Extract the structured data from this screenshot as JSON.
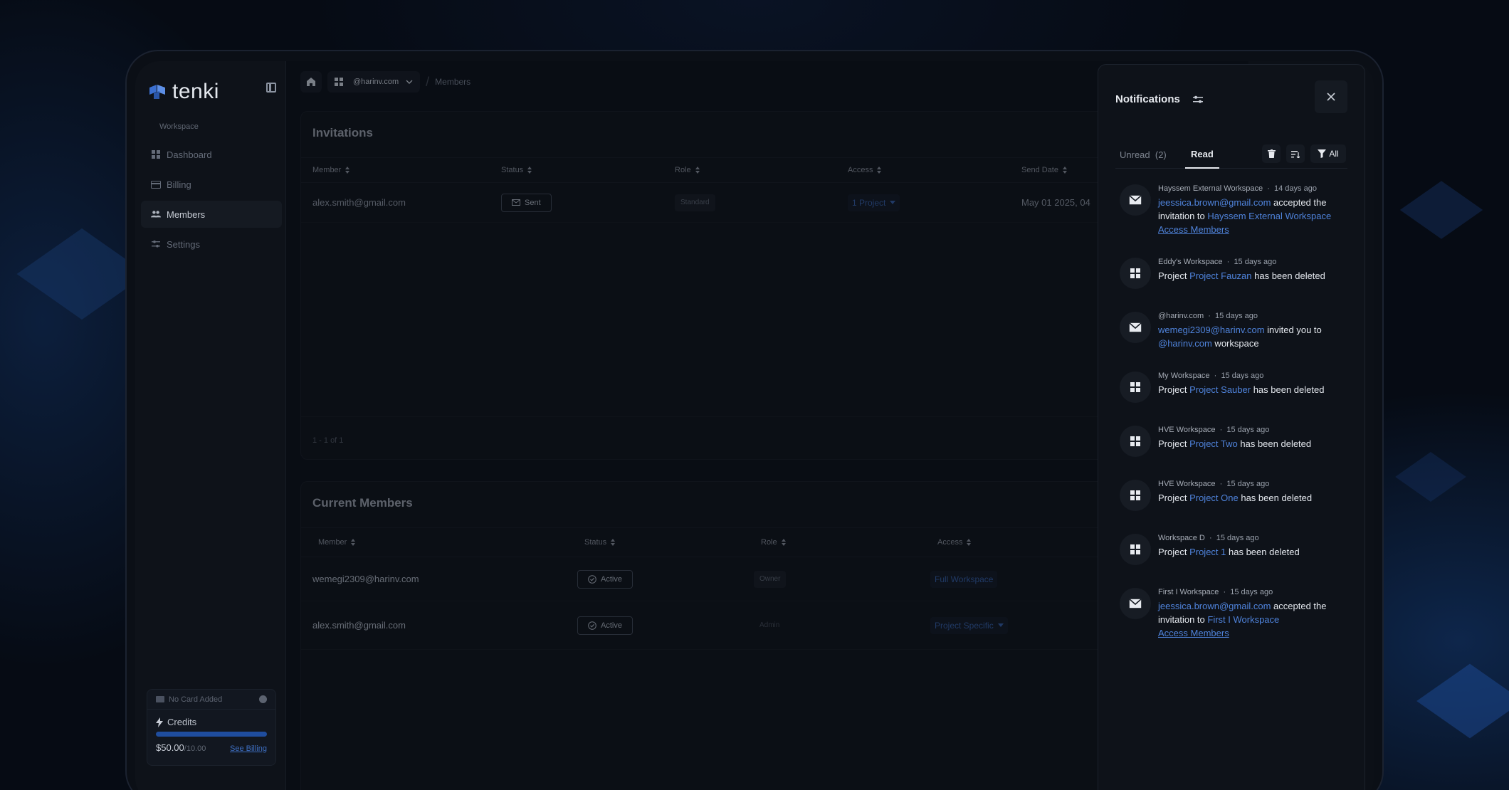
{
  "brand": {
    "name": "tenki",
    "accent": "#3e6fc2"
  },
  "sidebar": {
    "section_label": "Workspace",
    "items": [
      {
        "label": "Dashboard",
        "icon": "grid-icon",
        "active": false
      },
      {
        "label": "Billing",
        "icon": "card-icon",
        "active": false
      },
      {
        "label": "Members",
        "icon": "users-icon",
        "active": true
      },
      {
        "label": "Settings",
        "icon": "sliders-icon",
        "active": false
      }
    ],
    "credit_card": {
      "card_status": "No Card Added",
      "credits_label": "Credits",
      "amount": "$50.00",
      "limit": "/10.00",
      "progress": 1.0,
      "billing_link": "See Billing"
    }
  },
  "breadcrumb": {
    "workspace": "@harinv.com",
    "page": "Members"
  },
  "invitations": {
    "title": "Invitations",
    "columns": [
      "Member",
      "Status",
      "Role",
      "Access",
      "Send Date"
    ],
    "rows": [
      {
        "member": "alex.smith@gmail.com",
        "status": "Sent",
        "role": "Standard",
        "access": "1 Project",
        "send_date": "May 01 2025, 04"
      }
    ],
    "pagination": "1 - 1 of 1"
  },
  "current_members": {
    "title": "Current Members",
    "columns": [
      "Member",
      "Status",
      "Role",
      "Access"
    ],
    "rows": [
      {
        "member": "wemegi2309@harinv.com",
        "status": "Active",
        "role": "Owner",
        "access": "Full Workspace"
      },
      {
        "member": "alex.smith@gmail.com",
        "status": "Active",
        "role": "Admin",
        "access": "Project Specific"
      }
    ]
  },
  "notifications": {
    "title": "Notifications",
    "tabs": {
      "unread": "Unread",
      "unread_count": "(2)",
      "read": "Read"
    },
    "filter_label": "All",
    "items": [
      {
        "workspace": "Hayssem External Workspace",
        "time": "14 days ago",
        "icon": "mail-icon",
        "parts": [
          "jeessica.brown@gmail.com",
          " accepted the invitation to ",
          "Hayssem External Workspace",
          "Access Members"
        ]
      },
      {
        "workspace": "Eddy's Workspace",
        "time": "15 days ago",
        "icon": "grid-icon",
        "parts": [
          "Project ",
          "Project Fauzan",
          " has been deleted"
        ]
      },
      {
        "workspace": "@harinv.com",
        "time": "15 days ago",
        "icon": "mail-icon",
        "parts": [
          "wemegi2309@harinv.com",
          " invited you to ",
          "@harinv.com",
          " workspace"
        ]
      },
      {
        "workspace": "My Workspace",
        "time": "15 days ago",
        "icon": "grid-icon",
        "parts": [
          "Project ",
          "Project Sauber",
          " has been deleted"
        ]
      },
      {
        "workspace": "HVE Workspace",
        "time": "15 days ago",
        "icon": "grid-icon",
        "parts": [
          "Project ",
          "Project Two",
          " has been deleted"
        ]
      },
      {
        "workspace": "HVE Workspace",
        "time": "15 days ago",
        "icon": "grid-icon",
        "parts": [
          "Project ",
          "Project One",
          " has been deleted"
        ]
      },
      {
        "workspace": "Workspace D",
        "time": "15 days ago",
        "icon": "grid-icon",
        "parts": [
          "Project ",
          "Project 1",
          " has been deleted"
        ]
      },
      {
        "workspace": "First I Workspace",
        "time": "15 days ago",
        "icon": "mail-icon",
        "parts": [
          "jeessica.brown@gmail.com",
          " accepted the invitation to ",
          "First I Workspace",
          "Access Members"
        ]
      }
    ]
  }
}
